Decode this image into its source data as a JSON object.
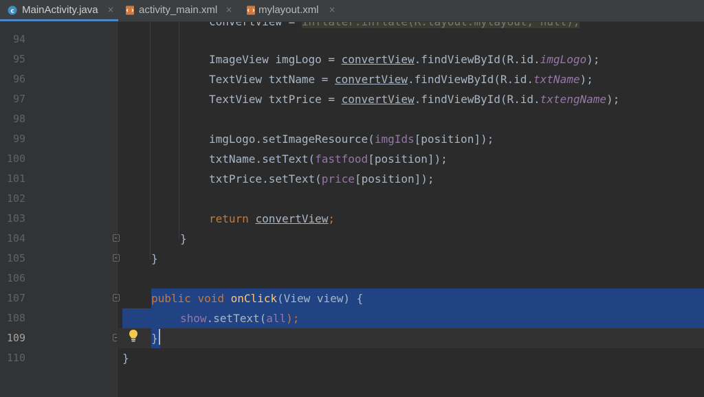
{
  "tabs": [
    {
      "label": "MainActivity.java",
      "icon": "java-class-icon",
      "active": true
    },
    {
      "label": "activity_main.xml",
      "icon": "xml-file-icon",
      "active": false
    },
    {
      "label": "mylayout.xml",
      "icon": "xml-file-icon",
      "active": false
    }
  ],
  "tab_close_glyph": "×",
  "line_numbers": [
    "94",
    "95",
    "96",
    "97",
    "98",
    "99",
    "100",
    "101",
    "102",
    "103",
    "104",
    "105",
    "106",
    "107",
    "108",
    "109",
    "110"
  ],
  "current_line": "109",
  "code": {
    "l95": {
      "t1": "ImageView imgLogo = ",
      "t2": "convertView",
      "t3": ".",
      "t4": "findViewById",
      "t5": "(R.id.",
      "t6": "imgLogo",
      "t7": ");"
    },
    "l96": {
      "t1": "TextView txtName = ",
      "t2": "convertView",
      "t3": ".",
      "t4": "findViewById",
      "t5": "(R.id.",
      "t6": "txtName",
      "t7": ");"
    },
    "l97": {
      "t1": "TextView txtPrice = ",
      "t2": "convertView",
      "t3": ".",
      "t4": "findViewById",
      "t5": "(R.id.",
      "t6": "txtengName",
      "t7": ");"
    },
    "l99": {
      "t1": "imgLogo.setImageResource(",
      "t2": "imgIds",
      "t3": "[position]);"
    },
    "l100": {
      "t1": "txtName.setText(",
      "t2": "fastfood",
      "t3": "[position]);"
    },
    "l101": {
      "t1": "txtPrice.setText(",
      "t2": "price",
      "t3": "[position]);"
    },
    "l103": {
      "kw": "return ",
      "t1": "convertView",
      "t2": ";"
    },
    "l104": {
      "t1": "}"
    },
    "l105": {
      "t1": "}"
    },
    "l107": {
      "kw1": "public ",
      "kw2": "void ",
      "fn": "onClick",
      "t1": "(View view) {"
    },
    "l108": {
      "fld": "show",
      "t1": ".setText(",
      "fld2": "all",
      "t2": ");"
    },
    "l109": {
      "t1": "}"
    },
    "l110": {
      "t1": "}"
    }
  }
}
